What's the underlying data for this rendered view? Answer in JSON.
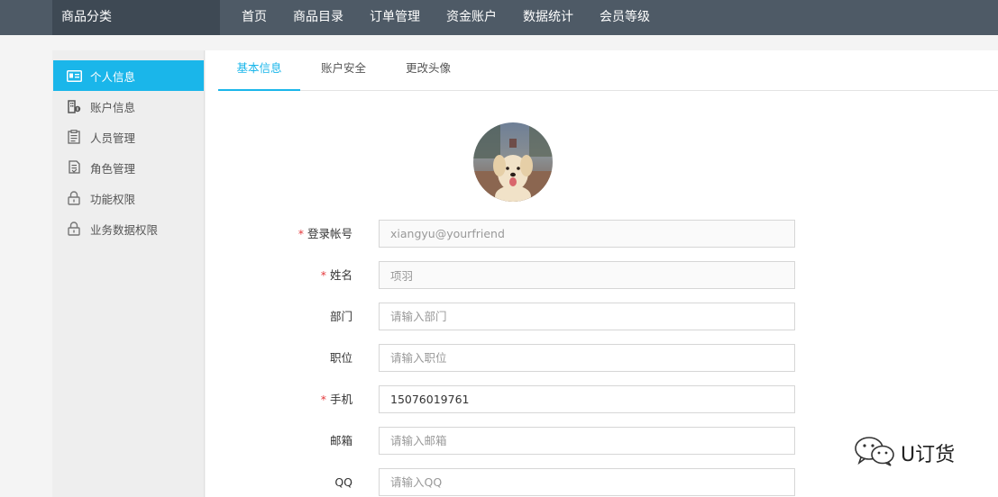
{
  "topbar": {
    "brand": "商品分类",
    "nav": [
      "首页",
      "商品目录",
      "订单管理",
      "资金账户",
      "数据统计",
      "会员等级"
    ]
  },
  "sidebar": {
    "items": [
      {
        "label": "个人信息",
        "icon": "id-card-icon",
        "active": true
      },
      {
        "label": "账户信息",
        "icon": "building-icon",
        "active": false
      },
      {
        "label": "人员管理",
        "icon": "clipboard-icon",
        "active": false
      },
      {
        "label": "角色管理",
        "icon": "document-icon",
        "active": false
      },
      {
        "label": "功能权限",
        "icon": "lock-icon",
        "active": false
      },
      {
        "label": "业务数据权限",
        "icon": "lock-icon",
        "active": false
      }
    ]
  },
  "tabs": [
    {
      "label": "基本信息",
      "active": true
    },
    {
      "label": "账户安全",
      "active": false
    },
    {
      "label": "更改头像",
      "active": false
    }
  ],
  "form": {
    "fields": [
      {
        "label": "登录帐号",
        "required": true,
        "value": "xiangyu@yourfriend",
        "placeholder": "",
        "readonly": true
      },
      {
        "label": "姓名",
        "required": true,
        "value": "项羽",
        "placeholder": "",
        "readonly": true
      },
      {
        "label": "部门",
        "required": false,
        "value": "",
        "placeholder": "请输入部门",
        "readonly": false
      },
      {
        "label": "职位",
        "required": false,
        "value": "",
        "placeholder": "请输入职位",
        "readonly": false
      },
      {
        "label": "手机",
        "required": true,
        "value": "15076019761",
        "placeholder": "",
        "readonly": false
      },
      {
        "label": "邮箱",
        "required": false,
        "value": "",
        "placeholder": "请输入邮箱",
        "readonly": false
      },
      {
        "label": "QQ",
        "required": false,
        "value": "",
        "placeholder": "请输入QQ",
        "readonly": false
      }
    ]
  },
  "watermark": {
    "text": "U订货",
    "icon": "wechat-icon"
  },
  "colors": {
    "accent": "#1ab6ea",
    "topbar": "#4e5a66",
    "brand_bg": "#3e4954",
    "required": "#e4393c"
  }
}
